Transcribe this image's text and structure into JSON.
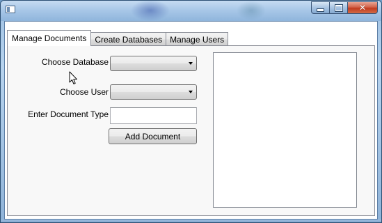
{
  "window": {
    "title": "",
    "controls": {
      "minimize_icon": "minimize-icon",
      "maximize_icon": "maximize-icon",
      "close_icon": "close-icon",
      "close_glyph": "✕"
    }
  },
  "tabs": [
    {
      "label": "Manage Documents",
      "active": true
    },
    {
      "label": "Create Databases",
      "active": false
    },
    {
      "label": "Manage Users",
      "active": false
    }
  ],
  "form": {
    "database_label": "Choose Database",
    "database_value": "",
    "user_label": "Choose User",
    "user_value": "",
    "doctype_label": "Enter Document Type",
    "doctype_value": "",
    "add_button_label": "Add Document"
  },
  "documents_list": {
    "items": []
  },
  "colors": {
    "tab_border": "#898c95",
    "panel_bg": "#f8f8f8",
    "close_button": "#c13b1f"
  }
}
